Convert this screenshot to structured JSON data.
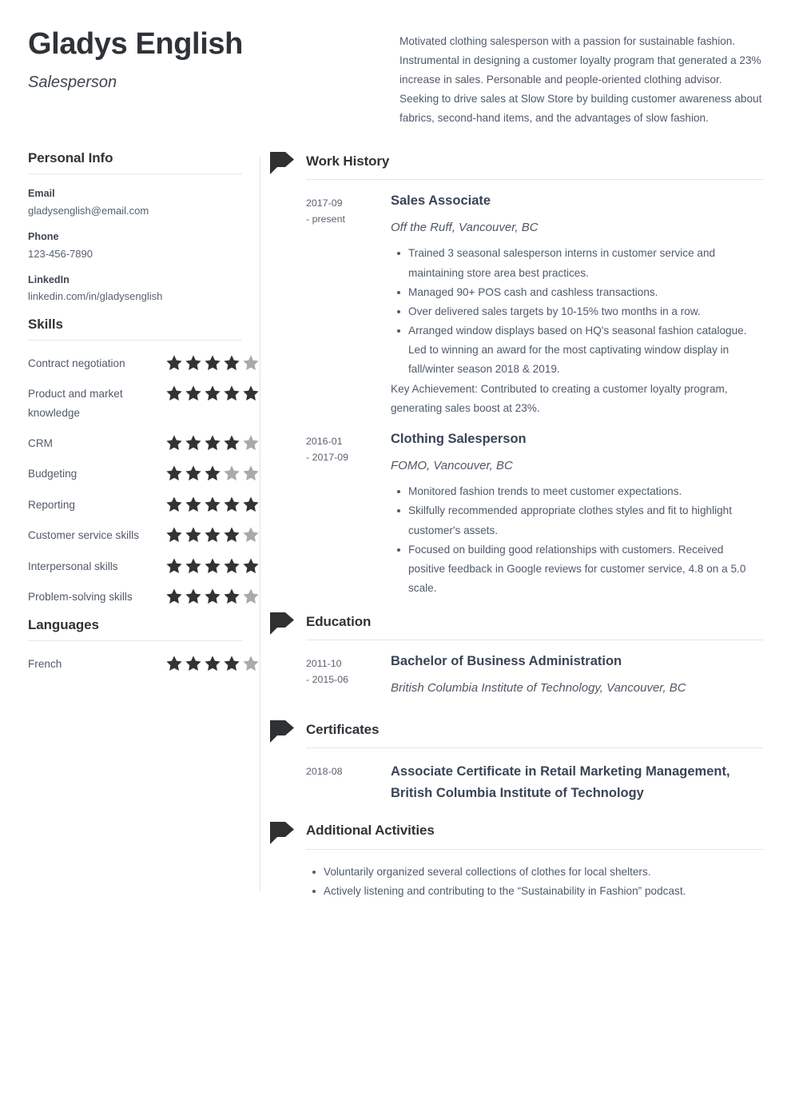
{
  "header": {
    "name": "Gladys English",
    "job_title": "Salesperson",
    "summary": "Motivated clothing salesperson with a passion for sustainable fashion. Instrumental in designing a customer loyalty program that generated a 23% increase in sales. Personable and people-oriented clothing advisor. Seeking to drive sales at Slow Store by building customer awareness about fabrics, second-hand items, and the advantages of slow fashion."
  },
  "colors": {
    "name_text": "#2f3337",
    "body_text": "#4f5a6b",
    "entry_title": "#3a4456",
    "star_filled": "#333333",
    "star_empty": "#aaaaaa",
    "rule": "#e4e6e8",
    "timeline": "#e1e3e6"
  },
  "sidebar": {
    "personal_info": {
      "heading": "Personal Info",
      "fields": [
        {
          "label": "Email",
          "value": "gladysenglish@email.com"
        },
        {
          "label": "Phone",
          "value": "123-456-7890"
        },
        {
          "label": "LinkedIn",
          "value": "linkedin.com/in/gladysenglish"
        }
      ]
    },
    "skills": {
      "heading": "Skills",
      "max_rating": 5,
      "items": [
        {
          "name": "Contract negotiation",
          "rating": 4
        },
        {
          "name": "Product and market knowledge",
          "rating": 5
        },
        {
          "name": "CRM",
          "rating": 4
        },
        {
          "name": "Budgeting",
          "rating": 3
        },
        {
          "name": "Reporting",
          "rating": 5
        },
        {
          "name": "Customer service skills",
          "rating": 4
        },
        {
          "name": "Interpersonal skills",
          "rating": 5
        },
        {
          "name": "Problem-solving skills",
          "rating": 4
        }
      ]
    },
    "languages": {
      "heading": "Languages",
      "max_rating": 5,
      "items": [
        {
          "name": "French",
          "rating": 4
        }
      ]
    }
  },
  "main": {
    "work_history": {
      "heading": "Work History",
      "entries": [
        {
          "dates": [
            "2017-09",
            "- present"
          ],
          "title": "Sales Associate",
          "subtitle": "Off the Ruff, Vancouver, BC",
          "bullets": [
            "Trained 3 seasonal salesperson interns in customer service and maintaining store area best practices.",
            "Managed 90+ POS cash and cashless transactions.",
            "Over delivered sales targets by 10-15% two months in a row.",
            "Arranged window displays based on HQ's seasonal fashion catalogue. Led to winning an award for the most captivating window display in fall/winter season 2018 & 2019."
          ],
          "key_achievement": "Key Achievement: Contributed to creating a customer loyalty program, generating sales boost at 23%."
        },
        {
          "dates": [
            "2016-01",
            "- 2017-09"
          ],
          "title": "Clothing Salesperson",
          "subtitle": "FOMO, Vancouver, BC",
          "bullets": [
            "Monitored fashion trends to meet customer expectations.",
            "Skilfully recommended appropriate clothes styles and fit to highlight customer's assets.",
            "Focused on building good relationships with customers. Received positive feedback in Google reviews for customer service, 4.8 on a 5.0 scale."
          ],
          "key_achievement": ""
        }
      ]
    },
    "education": {
      "heading": "Education",
      "entries": [
        {
          "dates": [
            "2011-10",
            "- 2015-06"
          ],
          "title": "Bachelor of Business Administration",
          "subtitle": "British Columbia Institute of Technology, Vancouver, BC"
        }
      ]
    },
    "certificates": {
      "heading": "Certificates",
      "entries": [
        {
          "dates": [
            "2018-08"
          ],
          "title": "Associate Certificate in Retail Marketing Management, British Columbia Institute of Technology"
        }
      ]
    },
    "additional_activities": {
      "heading": "Additional Activities",
      "bullets": [
        "Voluntarily organized several collections of clothes for local shelters.",
        "Actively listening and contributing to the “Sustainability in Fashion” podcast."
      ]
    }
  },
  "icons": {
    "pennant": "pennant-flag-icon",
    "star": "star-icon"
  }
}
